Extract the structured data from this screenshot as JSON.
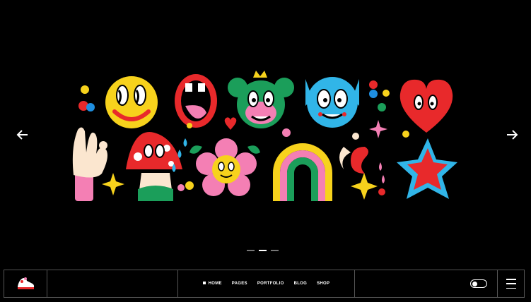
{
  "hero": {
    "slides_total": 3,
    "active_slide": 2,
    "illustration_set": [
      "smiley-face",
      "mouth-tongue",
      "crowned-bear",
      "blue-cat",
      "red-heart",
      "ok-hand",
      "mushroom",
      "flower-face",
      "rainbow",
      "abstract-shapes",
      "star"
    ]
  },
  "nav": {
    "items": [
      {
        "label": "HOME",
        "active": true
      },
      {
        "label": "PAGES",
        "active": false
      },
      {
        "label": "PORTFOLIO",
        "active": false
      },
      {
        "label": "BLOG",
        "active": false
      },
      {
        "label": "SHOP",
        "active": false
      }
    ]
  },
  "icons": {
    "prev": "arrow-left-icon",
    "next": "arrow-right-icon",
    "logo": "sneaker-logo-icon",
    "theme": "theme-toggle-icon",
    "menu": "hamburger-menu-icon"
  },
  "colors": {
    "background": "#000000",
    "border": "#555555",
    "text": "#ffffff"
  }
}
